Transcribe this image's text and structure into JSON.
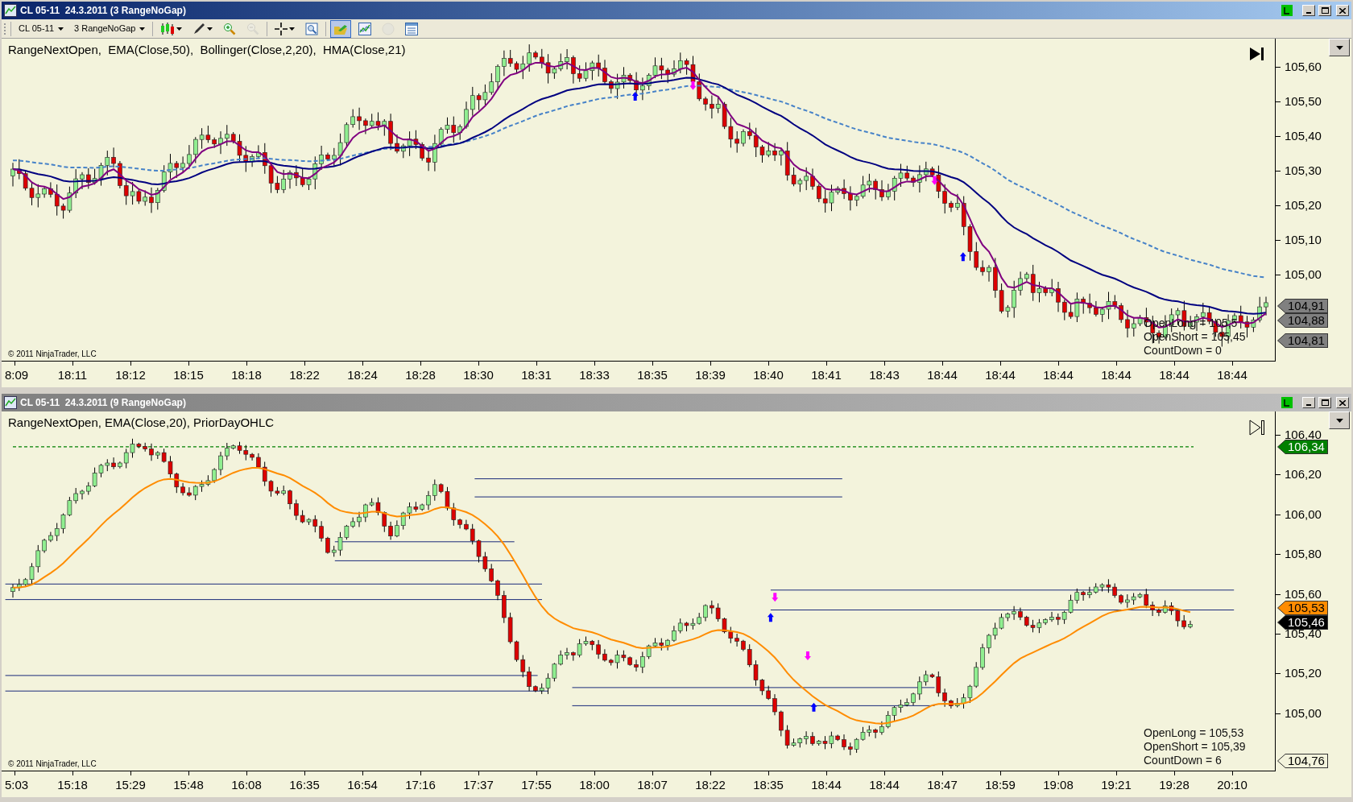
{
  "windows": [
    {
      "title": "CL 05-11  24.3.2011 (3 RangeNoGap)",
      "active": true,
      "toolbar": {
        "instrument": "CL 05-11",
        "period": "3 RangeNoGap",
        "tools": [
          {
            "kind": "bars",
            "menu": true,
            "selected": false,
            "disabled": false
          },
          {
            "kind": "draw",
            "menu": true,
            "selected": false,
            "disabled": false
          },
          {
            "kind": "zoom-in",
            "menu": false,
            "selected": false,
            "disabled": false
          },
          {
            "kind": "zoom-out",
            "menu": false,
            "selected": false,
            "disabled": true
          },
          {
            "kind": "crosshair",
            "menu": true,
            "selected": false,
            "disabled": false
          },
          {
            "kind": "properties",
            "menu": false,
            "selected": false,
            "disabled": false
          },
          {
            "kind": "data-box",
            "menu": false,
            "selected": true,
            "disabled": false
          },
          {
            "kind": "indicators",
            "menu": false,
            "selected": false,
            "disabled": false
          },
          {
            "kind": "strategies",
            "menu": false,
            "selected": false,
            "disabled": true
          },
          {
            "kind": "data-series",
            "menu": false,
            "selected": false,
            "disabled": false
          }
        ]
      },
      "indicators_label": "RangeNextOpen,  EMA(Close,50),  Bollinger(Close,2,20),  HMA(Close,21)",
      "end_marker_filled": true,
      "price_axis": [
        "105,60",
        "105,50",
        "105,40",
        "105,30",
        "105,20",
        "105,10",
        "105,00"
      ],
      "price_markers": [
        {
          "label": "104,91",
          "color": "#808080"
        },
        {
          "label": "104,88",
          "color": "#808080"
        },
        {
          "label": "104,81",
          "color": "#808080"
        }
      ],
      "stats": [
        "OpenLong = 105,5",
        "OpenShort = 105,45",
        "CountDown = 0"
      ],
      "copyright": "© 2011 NinjaTrader, LLC",
      "time_axis": [
        "8:09",
        "18:11",
        "18:12",
        "18:15",
        "18:18",
        "18:22",
        "18:24",
        "18:28",
        "18:30",
        "18:31",
        "18:33",
        "18:35",
        "18:39",
        "18:40",
        "18:41",
        "18:43",
        "18:44",
        "18:44",
        "18:44",
        "18:44",
        "18:44",
        "18:44"
      ]
    },
    {
      "title": "CL 05-11  24.3.2011 (9 RangeNoGap)",
      "active": false,
      "indicators_label": "RangeNextOpen, EMA(Close,20), PriorDayOHLC",
      "end_marker_filled": false,
      "price_axis": [
        "106,40",
        "106,20",
        "106,00",
        "105,80",
        "105,60",
        "105,40",
        "105,20",
        "105,00"
      ],
      "price_markers": [
        {
          "label": "106,34",
          "color": "#008000"
        },
        {
          "label": "105,53",
          "color": "#ff8c00"
        },
        {
          "label": "105,46",
          "color": "#000000"
        },
        {
          "label": "104,76",
          "color": "#f3f3dc"
        }
      ],
      "stats": [
        "OpenLong = 105,53",
        "OpenShort = 105,39",
        "CountDown = 6"
      ],
      "copyright": "© 2011 NinjaTrader, LLC",
      "time_axis": [
        "5:03",
        "15:18",
        "15:29",
        "15:48",
        "16:08",
        "16:35",
        "16:54",
        "17:16",
        "17:37",
        "17:55",
        "18:00",
        "18:07",
        "18:22",
        "18:35",
        "18:44",
        "18:44",
        "18:47",
        "18:59",
        "19:08",
        "19:21",
        "19:28",
        "20:10"
      ]
    }
  ]
}
